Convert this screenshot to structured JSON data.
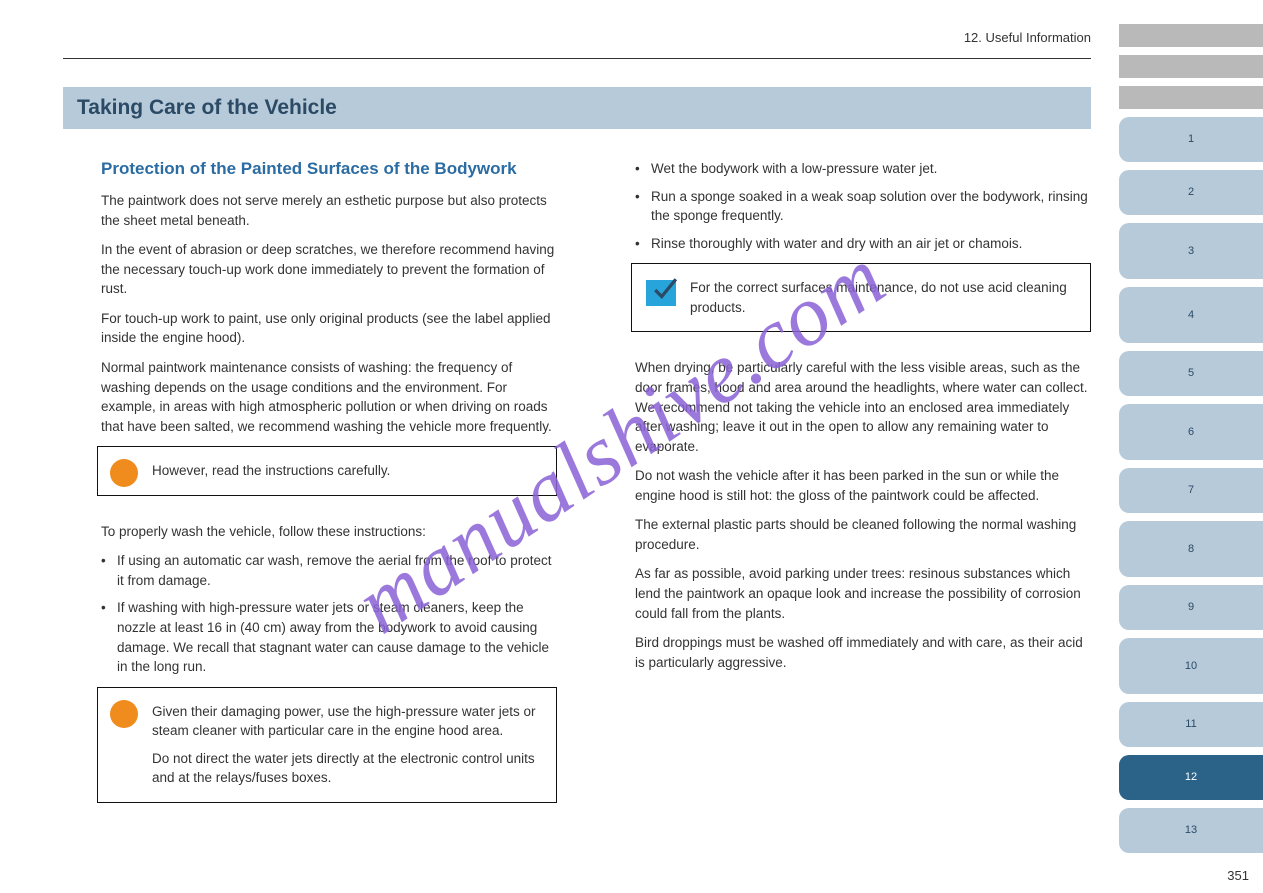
{
  "chapter_label": "12. Useful Information",
  "section_title": "Taking Care of the Vehicle",
  "left": {
    "sub1": "Protection of the Painted Surfaces of the Bodywork",
    "p1": "The paintwork does not serve merely an esthetic purpose but also protects the sheet metal beneath.",
    "p2": "In the event of abrasion or deep scratches, we therefore recommend having the necessary touch-up work done immediately to prevent the formation of rust.",
    "p3": "For touch-up work to paint, use only original products (see the label applied inside the engine hood).",
    "p4": "Normal paintwork maintenance consists of washing: the frequency of washing depends on the usage conditions and the environment. For example, in areas with high atmospheric pollution or when driving on roads that have been salted, we recommend washing the vehicle more frequently.",
    "box1": "However, read the instructions carefully.",
    "p5": "To properly wash the vehicle, follow these instructions:",
    "li1": "If using an automatic car wash, remove the aerial from the roof to protect it from damage.",
    "li2": "If washing with high-pressure water jets or steam cleaners, keep the nozzle at least 16 in (40 cm) away from the bodywork to avoid causing damage. We recall that stagnant water can cause damage to the vehicle in the long run.",
    "box2_l1": "Given their damaging power, use the high-pressure water jets or steam cleaner with particular care in the engine hood area.",
    "box2_l2": "Do not direct the water jets directly at the electronic control units and at the relays/fuses boxes."
  },
  "right": {
    "li3": "Wet the bodywork with a low-pressure water jet.",
    "li4": "Run a sponge soaked in a weak soap solution over the bodywork, rinsing the sponge frequently.",
    "li5": "Rinse thoroughly with water and dry with an air jet or chamois.",
    "note": "For the correct surfaces maintenance, do not use acid cleaning products.",
    "p6": "When drying, be particularly careful with the less visible areas, such as the door frames, hood and area around the headlights, where water can collect. We recommend not taking the vehicle into an enclosed area immediately after washing; leave it out in the open to allow any remaining water to evaporate.",
    "p7": "Do not wash the vehicle after it has been parked in the sun or while the engine hood is still hot: the gloss of the paintwork could be affected.",
    "p8": "The external plastic parts should be cleaned following the normal washing procedure.",
    "p9": "As far as possible, avoid parking under trees: resinous substances which lend the paintwork an opaque look and increase the possibility of corrosion could fall from the plants.",
    "p10": "Bird droppings must be washed off immediately and with care, as their acid is particularly aggressive."
  },
  "sidebar": [
    {
      "cls": "gray",
      "txt": ""
    },
    {
      "cls": "gray",
      "txt": ""
    },
    {
      "cls": "gray",
      "txt": ""
    },
    {
      "cls": "",
      "txt": "1"
    },
    {
      "cls": "",
      "txt": "2"
    },
    {
      "cls": "tall",
      "txt": "3"
    },
    {
      "cls": "tall",
      "txt": "4"
    },
    {
      "cls": "",
      "txt": "5"
    },
    {
      "cls": "tall",
      "txt": "6"
    },
    {
      "cls": "",
      "txt": "7"
    },
    {
      "cls": "tall",
      "txt": "8"
    },
    {
      "cls": "",
      "txt": "9"
    },
    {
      "cls": "tall",
      "txt": "10"
    },
    {
      "cls": "",
      "txt": "11"
    },
    {
      "cls": "active",
      "txt": "12"
    },
    {
      "cls": "",
      "txt": "13"
    }
  ],
  "page_number": "351",
  "watermark": "manualshive.com"
}
